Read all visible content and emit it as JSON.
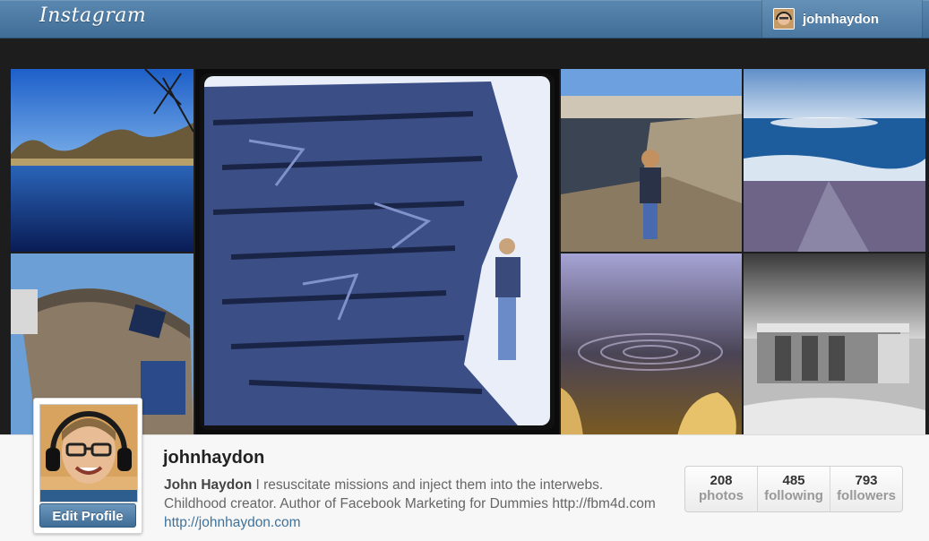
{
  "app": {
    "logo_text": "Instagram"
  },
  "header": {
    "username": "johnhaydon"
  },
  "photos": [
    {
      "id": "lake-reflection"
    },
    {
      "id": "rock-cliff-climber"
    },
    {
      "id": "boy-on-beach"
    },
    {
      "id": "ocean-sunlight"
    },
    {
      "id": "stone-tower"
    },
    {
      "id": "water-ripples"
    },
    {
      "id": "beach-shed-bw"
    }
  ],
  "profile": {
    "username": "johnhaydon",
    "full_name": "John Haydon",
    "bio_text": " I resuscitate missions and inject them into the interwebs. Childhood creator. Author of Facebook Marketing for Dummies http://fbm4d.com ",
    "website": "http://johnhaydon.com",
    "edit_label": "Edit Profile"
  },
  "stats": [
    {
      "value": "208",
      "label": "photos"
    },
    {
      "value": "485",
      "label": "following"
    },
    {
      "value": "793",
      "label": "followers"
    }
  ],
  "colors": {
    "header": "#4a77a0",
    "link": "#3f729b"
  }
}
